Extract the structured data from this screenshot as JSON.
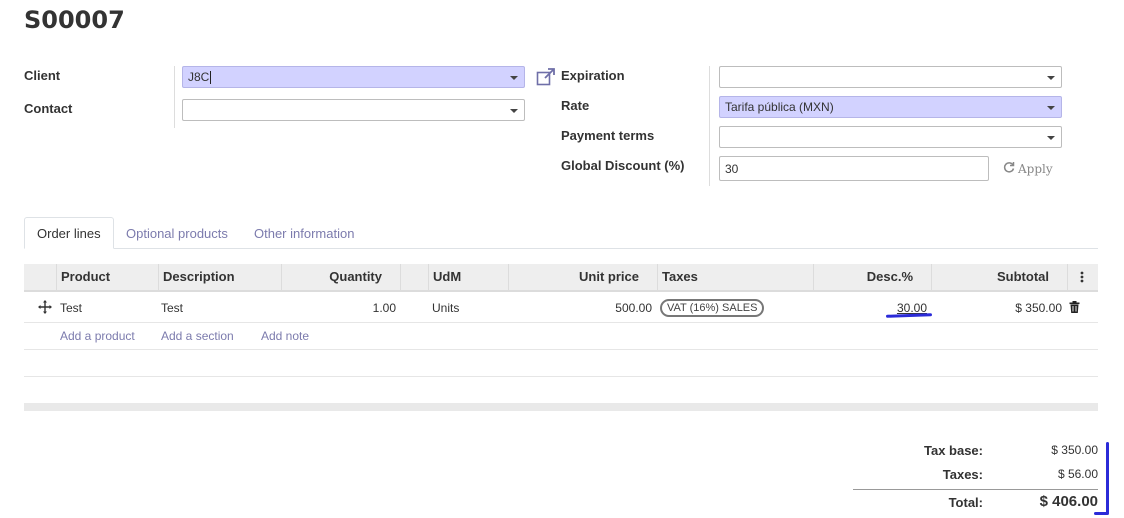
{
  "record": {
    "title": "S00007"
  },
  "form": {
    "client": {
      "label": "Client",
      "value": "J8C"
    },
    "contact": {
      "label": "Contact",
      "value": ""
    },
    "expiration": {
      "label": "Expiration",
      "value": ""
    },
    "rate": {
      "label": "Rate",
      "value": "Tarifa pública (MXN)"
    },
    "payment_terms": {
      "label": "Payment terms",
      "value": ""
    },
    "global_discount": {
      "label": "Global Discount (%)",
      "value": "30",
      "apply_label": "Apply"
    }
  },
  "tabs": [
    {
      "label": "Order lines",
      "active": true
    },
    {
      "label": "Optional products",
      "active": false
    },
    {
      "label": "Other information",
      "active": false
    }
  ],
  "table": {
    "columns": {
      "product": "Product",
      "description": "Description",
      "quantity": "Quantity",
      "udm": "UdM",
      "unit_price": "Unit price",
      "taxes": "Taxes",
      "discount": "Desc.%",
      "subtotal": "Subtotal"
    },
    "rows": [
      {
        "product": "Test",
        "description": "Test",
        "quantity": "1.00",
        "udm": "Units",
        "unit_price": "500.00",
        "taxes": "VAT (16%) SALES",
        "discount": "30.00",
        "subtotal": "$ 350.00"
      }
    ],
    "add_links": {
      "product": "Add a product",
      "section": "Add a section",
      "note": "Add note"
    }
  },
  "totals": {
    "tax_base_label": "Tax base:",
    "tax_base": "$ 350.00",
    "taxes_label": "Taxes:",
    "taxes": "$ 56.00",
    "total_label": "Total:",
    "total": "$ 406.00"
  },
  "colors": {
    "required_field": "#d2d2ff",
    "link": "#7c7bad",
    "annotation": "#2b2bd8"
  },
  "icons": [
    "external-link-icon",
    "refresh-icon",
    "drag-handle-icon",
    "trash-icon",
    "column-options-icon"
  ]
}
